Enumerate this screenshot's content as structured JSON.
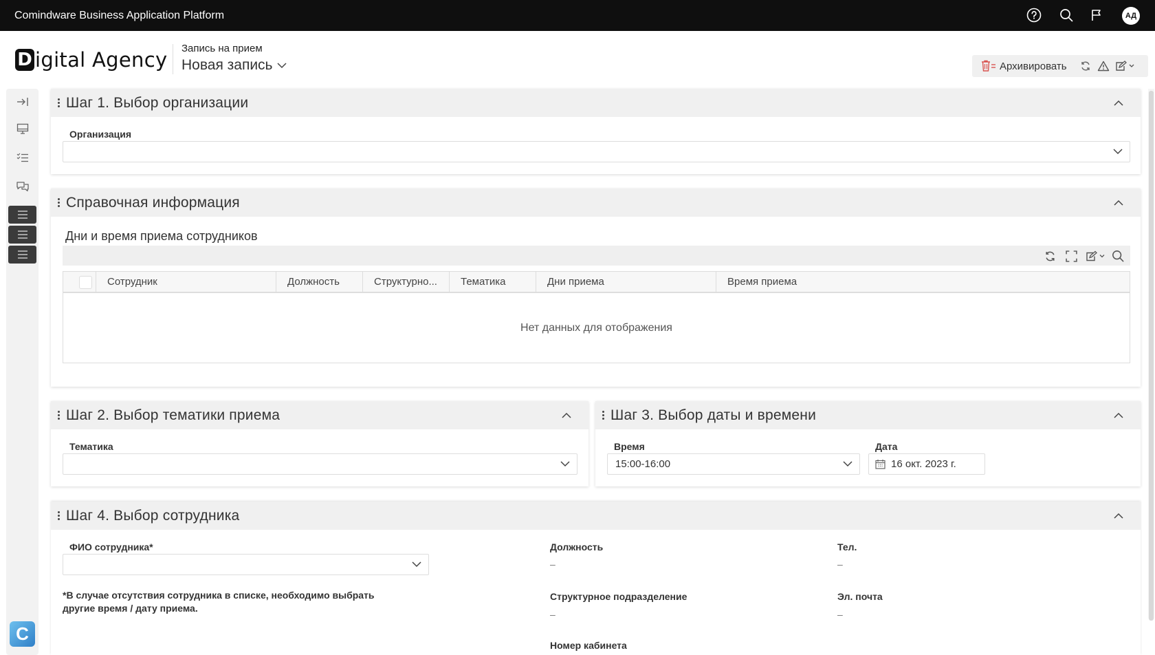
{
  "topbar": {
    "app_title": "Comindware Business Application Platform",
    "avatar_initials": "АД",
    "icons": [
      "help-icon",
      "search-icon",
      "flag-icon"
    ]
  },
  "header": {
    "logo_letter": "D",
    "logo_text": "igital Agency",
    "form_name": "Запись на прием",
    "record_title": "Новая запись",
    "archive_label": "Архивировать"
  },
  "sidebar": {
    "icons": [
      "expand-sidebar-icon",
      "desktop-icon",
      "checklist-icon",
      "chat-icon"
    ],
    "menu_blocks": 3,
    "brand_letter": "C"
  },
  "step1": {
    "title": "Шаг 1. Выбор организации",
    "org_label": "Организация",
    "org_value": ""
  },
  "reference": {
    "title": "Справочная информация",
    "table_title": "Дни и время приема сотрудников",
    "columns": [
      "Сотрудник",
      "Должность",
      "Структурно...",
      "Тематика",
      "Дни приема",
      "Время приема"
    ],
    "empty_message": "Нет данных для отображения"
  },
  "step2": {
    "title": "Шаг 2. Выбор тематики приема",
    "topic_label": "Тематика",
    "topic_value": ""
  },
  "step3": {
    "title": "Шаг 3. Выбор даты и времени",
    "time_label": "Время",
    "time_value": "15:00-16:00",
    "date_label": "Дата",
    "date_value": "16 окт. 2023 г."
  },
  "step4": {
    "title": "Шаг 4. Выбор сотрудника",
    "employee_label": "ФИО сотрудника*",
    "employee_value": "",
    "note_line1": "*В случае отсутствия сотрудника в списке, необходимо выбрать",
    "note_line2": "другие время / дату приема.",
    "position_label": "Должность",
    "position_value": "–",
    "department_label": "Структурное подразделение",
    "department_value": "–",
    "room_label": "Номер кабинета",
    "phone_label": "Тел.",
    "phone_value": "–",
    "email_label": "Эл. почта",
    "email_value": "–"
  },
  "colors": {
    "topbar_bg": "#0f0f0f",
    "panel_head_bg": "#f0f0f0",
    "archive_icon": "#d9534f",
    "brand_logo": "#3f8fd4"
  }
}
